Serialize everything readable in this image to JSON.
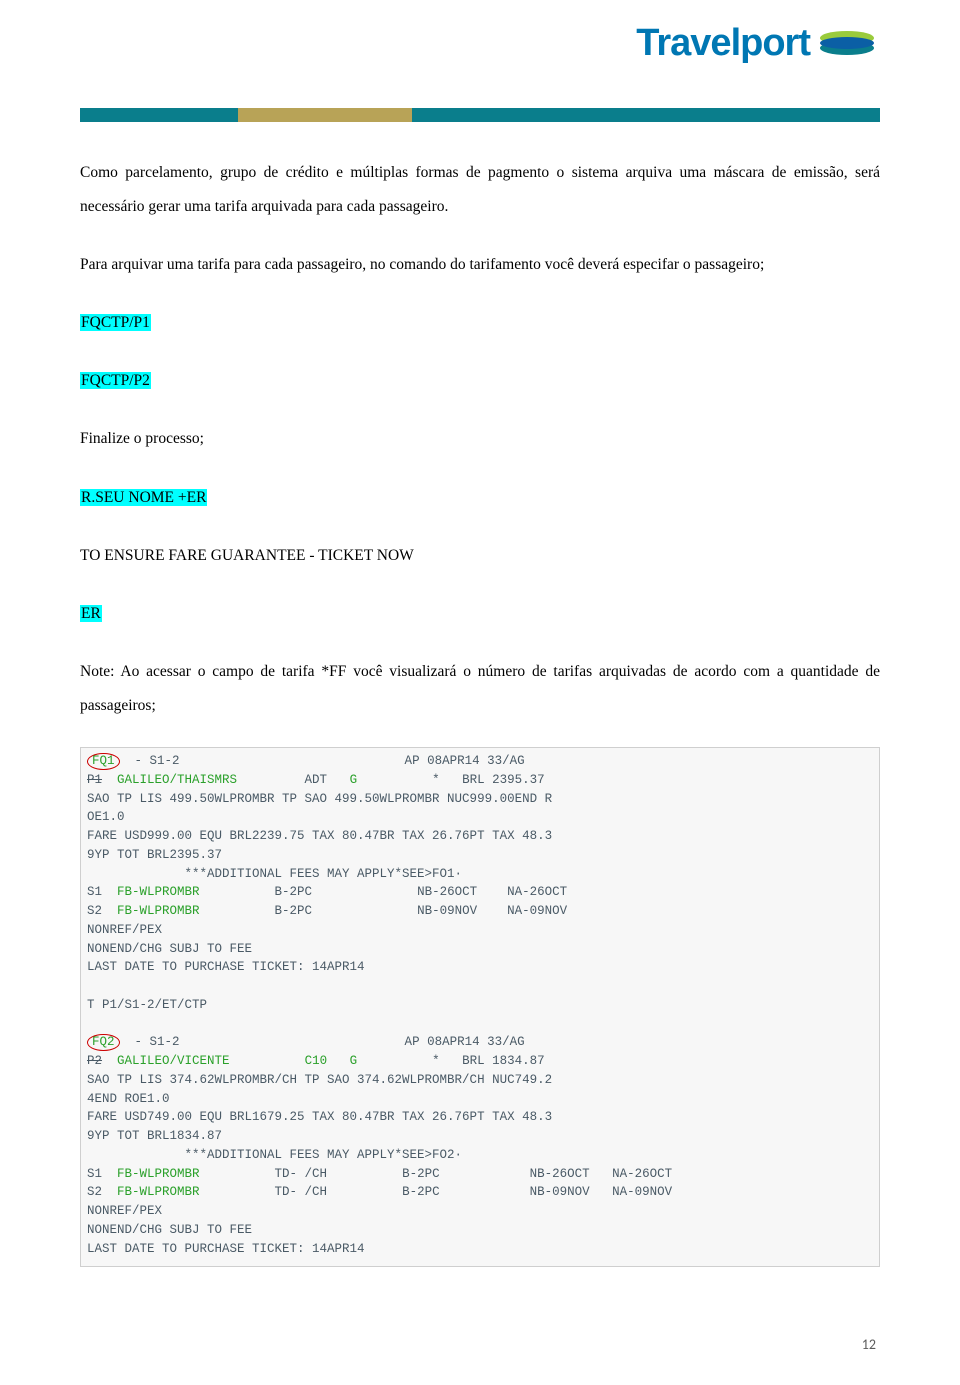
{
  "logo_text": "Travelport",
  "para1": "Como parcelamento, grupo de crédito e múltiplas formas de pagmento o sistema arquiva uma máscara de emissão, será necessário gerar uma tarifa arquivada para cada passageiro.",
  "para2": "Para arquivar uma tarifa para cada passageiro, no comando do tarifamento você deverá especifar o passageiro;",
  "cmd1": "FQCTP/P1",
  "cmd2": "FQCTP/P2",
  "line_finalize": "Finalize o processo;",
  "cmd3": "R.SEU NOME +ER",
  "line_guarantee": "TO ENSURE FARE GUARANTEE - TICKET NOW",
  "cmd4": "ER",
  "line_note": "Note: Ao acessar o campo de tarifa *FF você visualizará o número de tarifas arquivadas de acordo com a quantidade de passageiros;",
  "terminal": {
    "fq1": {
      "id": "FQ1",
      "header_rest": "  - S1-2                              AP 08APR14 33/AG",
      "l2": "P1  GALILEO/THAISMRS         ADT   G          *   BRL 2395.37",
      "l3": "SAO TP LIS 499.50WLPROMBR TP SAO 499.50WLPROMBR NUC999.00END R",
      "l4": "OE1.0",
      "l5": "FARE USD999.00 EQU BRL2239.75 TAX 80.47BR TAX 26.76PT TAX 48.3",
      "l6": "9YP TOT BRL2395.37",
      "l7": "             ***ADDITIONAL FEES MAY APPLY*SEE>FO1·",
      "l8": "S1  FB-WLPROMBR          B-2PC              NB-26OCT    NA-26OCT",
      "l9": "S2  FB-WLPROMBR          B-2PC              NB-09NOV    NA-09NOV",
      "l10": "NONREF/PEX",
      "l11": "NONEND/CHG SUBJ TO FEE",
      "l12": "LAST DATE TO PURCHASE TICKET: 14APR14",
      "l13": " ",
      "l14": "T P1/S1-2/ET/CTP"
    },
    "fq2": {
      "id": "FQ2",
      "header_rest": "  - S1-2                              AP 08APR14 33/AG",
      "l2": "P2  GALILEO/VICENTE          C10   G          *   BRL 1834.87",
      "l3": "SAO TP LIS 374.62WLPROMBR/CH TP SAO 374.62WLPROMBR/CH NUC749.2",
      "l4": "4END ROE1.0",
      "l5": "FARE USD749.00 EQU BRL1679.25 TAX 80.47BR TAX 26.76PT TAX 48.3",
      "l6": "9YP TOT BRL1834.87",
      "l7": "             ***ADDITIONAL FEES MAY APPLY*SEE>FO2·",
      "l8": "S1  FB-WLPROMBR          TD- /CH          B-2PC            NB-26OCT   NA-26OCT",
      "l9": "S2  FB-WLPROMBR          TD- /CH          B-2PC            NB-09NOV   NA-09NOV",
      "l10": "NONREF/PEX",
      "l11": "NONEND/CHG SUBJ TO FEE",
      "l12": "LAST DATE TO PURCHASE TICKET: 14APR14"
    }
  },
  "page_number": "12"
}
